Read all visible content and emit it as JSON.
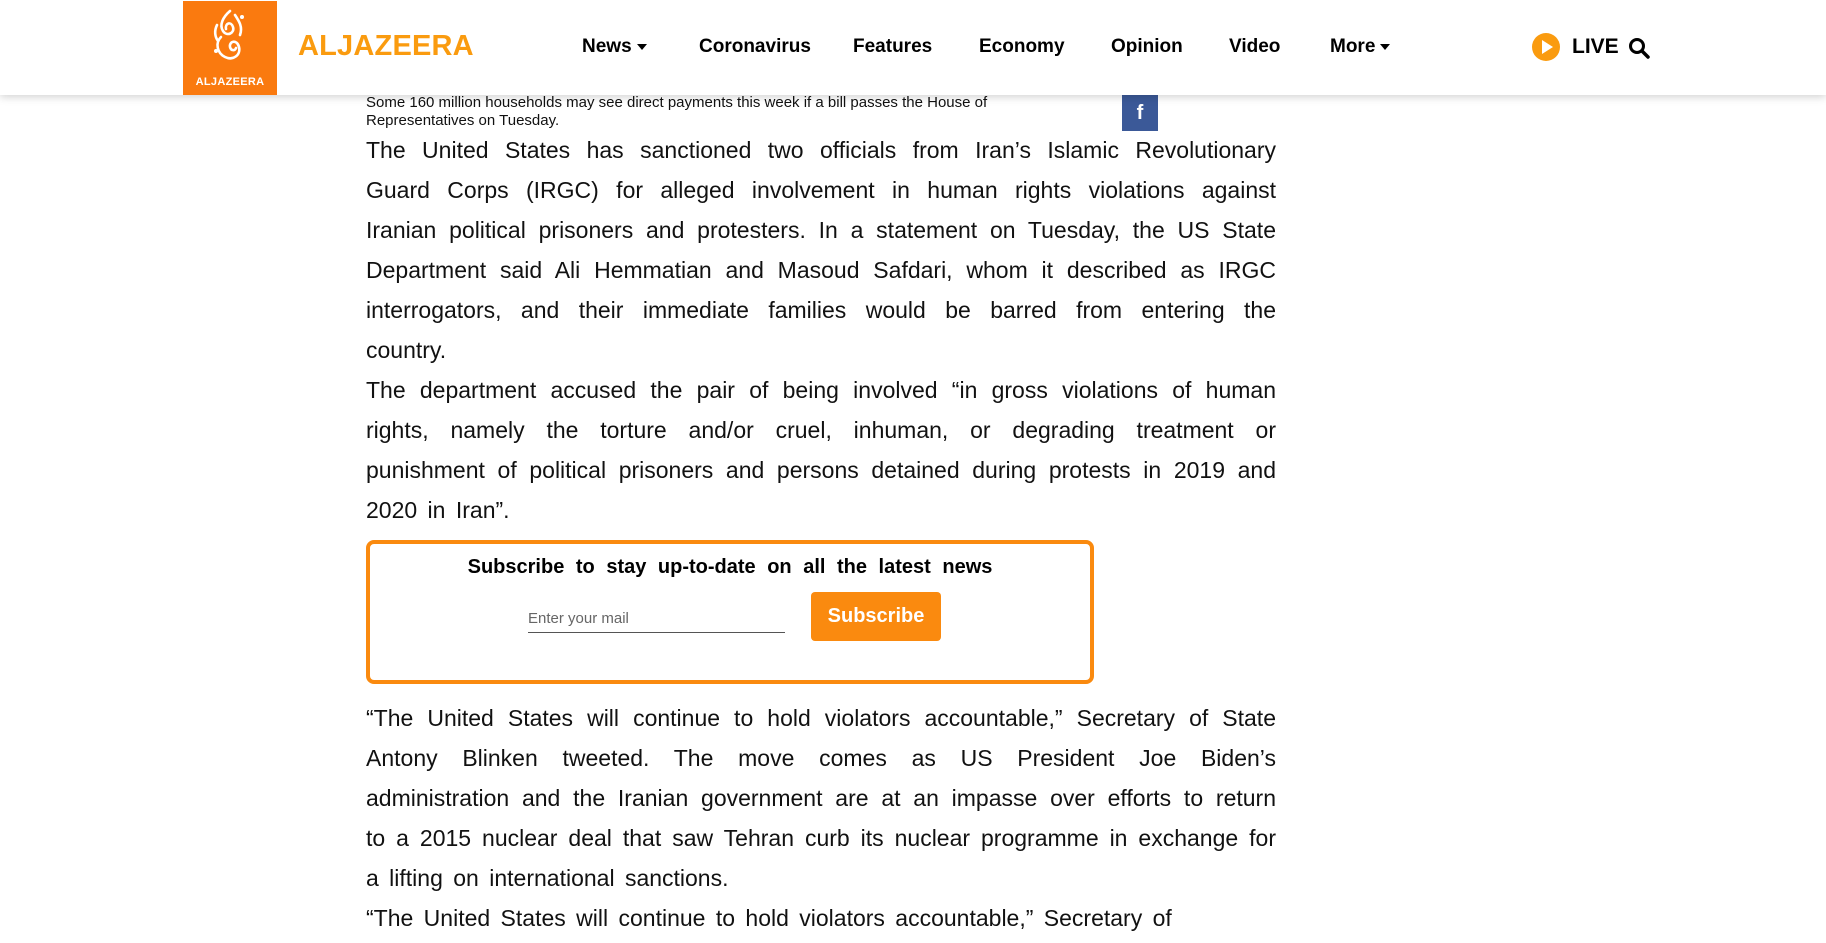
{
  "header": {
    "logo_caption": "ALJAZEERA",
    "brand": "ALJAZEERA",
    "nav": [
      {
        "label": "News",
        "dropdown": true
      },
      {
        "label": "Coronavirus",
        "dropdown": false
      },
      {
        "label": "Features",
        "dropdown": false
      },
      {
        "label": "Economy",
        "dropdown": false
      },
      {
        "label": "Opinion",
        "dropdown": false
      },
      {
        "label": "Video",
        "dropdown": false
      },
      {
        "label": "More",
        "dropdown": true
      }
    ],
    "live_label": "LIVE",
    "brand_color": "#fa9b0f"
  },
  "article": {
    "caption": "Some 160 million households may see direct payments this week if a bill passes the House of Representatives on Tuesday.",
    "share_icon": "facebook-icon",
    "paragraphs": [
      "The United States has sanctioned two officials from Iran’s Islamic Revolutionary Guard Corps (IRGC) for alleged involvement in human rights violations against Iranian political prisoners and protesters. In a statement on Tuesday, the US State Department said Ali Hemmatian and Masoud Safdari, whom it described as IRGC interrogators, and their immediate families would be barred from entering the country.",
      "The department accused the pair of being involved “in gross violations of human rights, namely the torture and/or cruel, inhuman, or degrading treatment or punishment of political prisoners and persons detained during protests in 2019 and 2020 in Iran”.",
      "“The United States will continue to hold violators accountable,” Secretary of State Antony Blinken tweeted. The move comes as US President Joe Biden’s administration and the Iranian government are at an impasse over efforts to return to a 2015 nuclear deal that saw Tehran curb its nuclear programme in exchange for a lifting on international sanctions.",
      "“The United States will continue to hold violators accountable,” Secretary of"
    ]
  },
  "subscribe": {
    "title": "Subscribe to stay up-to-date on all the latest news",
    "placeholder": "Enter your mail",
    "value": "",
    "button_label": "Subscribe",
    "accent_color": "#fa8a0f"
  }
}
